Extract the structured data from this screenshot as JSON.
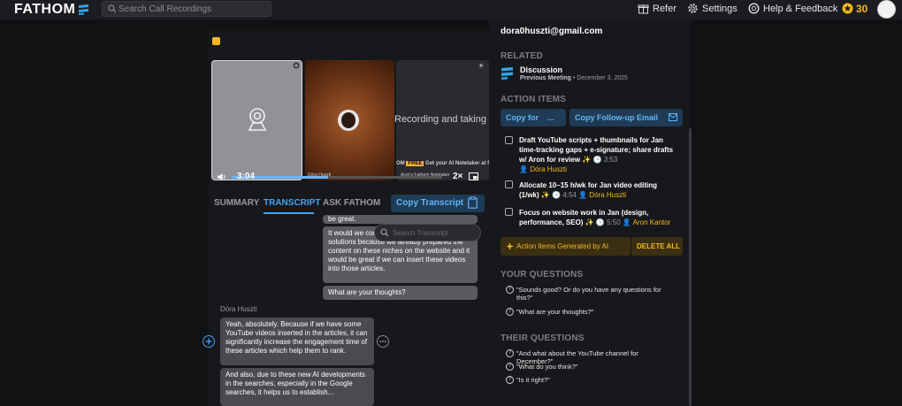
{
  "header": {
    "logo": "FATHOM",
    "search_placeholder": "Search Call Recordings",
    "refer": "Refer",
    "settings": "Settings",
    "help": "Help & Feedback",
    "credits": "30"
  },
  "player": {
    "tile3_caption": "Recording and taking notes",
    "time": "3:04",
    "speed": "2×",
    "progress_fraction": 0.46,
    "mini_banner": "Get your AI Notetaker at fathom",
    "mini_name_1": "Dóra Huszti",
    "mini_name_2": "Aron's Fathom Notetaker"
  },
  "tabs": {
    "summary": "SUMMARY",
    "transcript": "TRANSCRIPT",
    "ask": "ASK FATHOM",
    "copy_transcript": "Copy Transcript"
  },
  "transcript": {
    "search_placeholder": "Search Transcript",
    "bubble_top": "be great.",
    "bubble_2": "It would we could and also as signature solutions because we already prepared the content on these niches on the website and it would be great if we can insert these videos into those articles.",
    "bubble_3": "What are your thoughts?",
    "speaker": "Dóra Huszti",
    "bubble_4": "Yeah, absolutely. Because if we have some YouTube videos inserted in the articles, it can significantly increase the engagement time of these articles which help them to rank.",
    "bubble_5": "And also, due to these new AI developments in the searches, especially in the Google searches, it helps us to establish..."
  },
  "sidebar": {
    "email": "dora0huszti@gmail.com",
    "related_label": "RELATED",
    "related_title": "Discussion",
    "related_sub_bold": "Previous Meeting",
    "related_sub_date": "• December 3, 2025",
    "action_items_label": "ACTION ITEMS",
    "copy_for": "Copy for",
    "copy_for_more": "...",
    "copy_followup": "Copy Follow-up Email",
    "items": [
      {
        "text": "Draft YouTube scripts + thumbnails for Jan time-tracking gaps + e-signature; share drafts w/ Aron for review",
        "time": "3:53",
        "assignee": "Dóra Huszti"
      },
      {
        "text": "Allocate 10–15 h/wk for Jan video editing (1/wk)",
        "time": "4:54",
        "assignee": "Dóra Huszti"
      },
      {
        "text": "Focus on website work in Jan (design, performance, SEO)",
        "time": "5:50",
        "assignee": "Aron Kantor"
      }
    ],
    "ai_generated": "Action Items Generated by AI",
    "delete_all": "DELETE ALL",
    "your_questions_label": "YOUR QUESTIONS",
    "your_questions": [
      "\"Sounds good? Or do you have any questions for this?\"",
      "\"What are your thoughts?\""
    ],
    "their_questions_label": "THEIR QUESTIONS",
    "their_questions": [
      "\"And what about the YouTube channel for December?\"",
      "\"What do you think?\"",
      "\"Is it right?\""
    ]
  }
}
